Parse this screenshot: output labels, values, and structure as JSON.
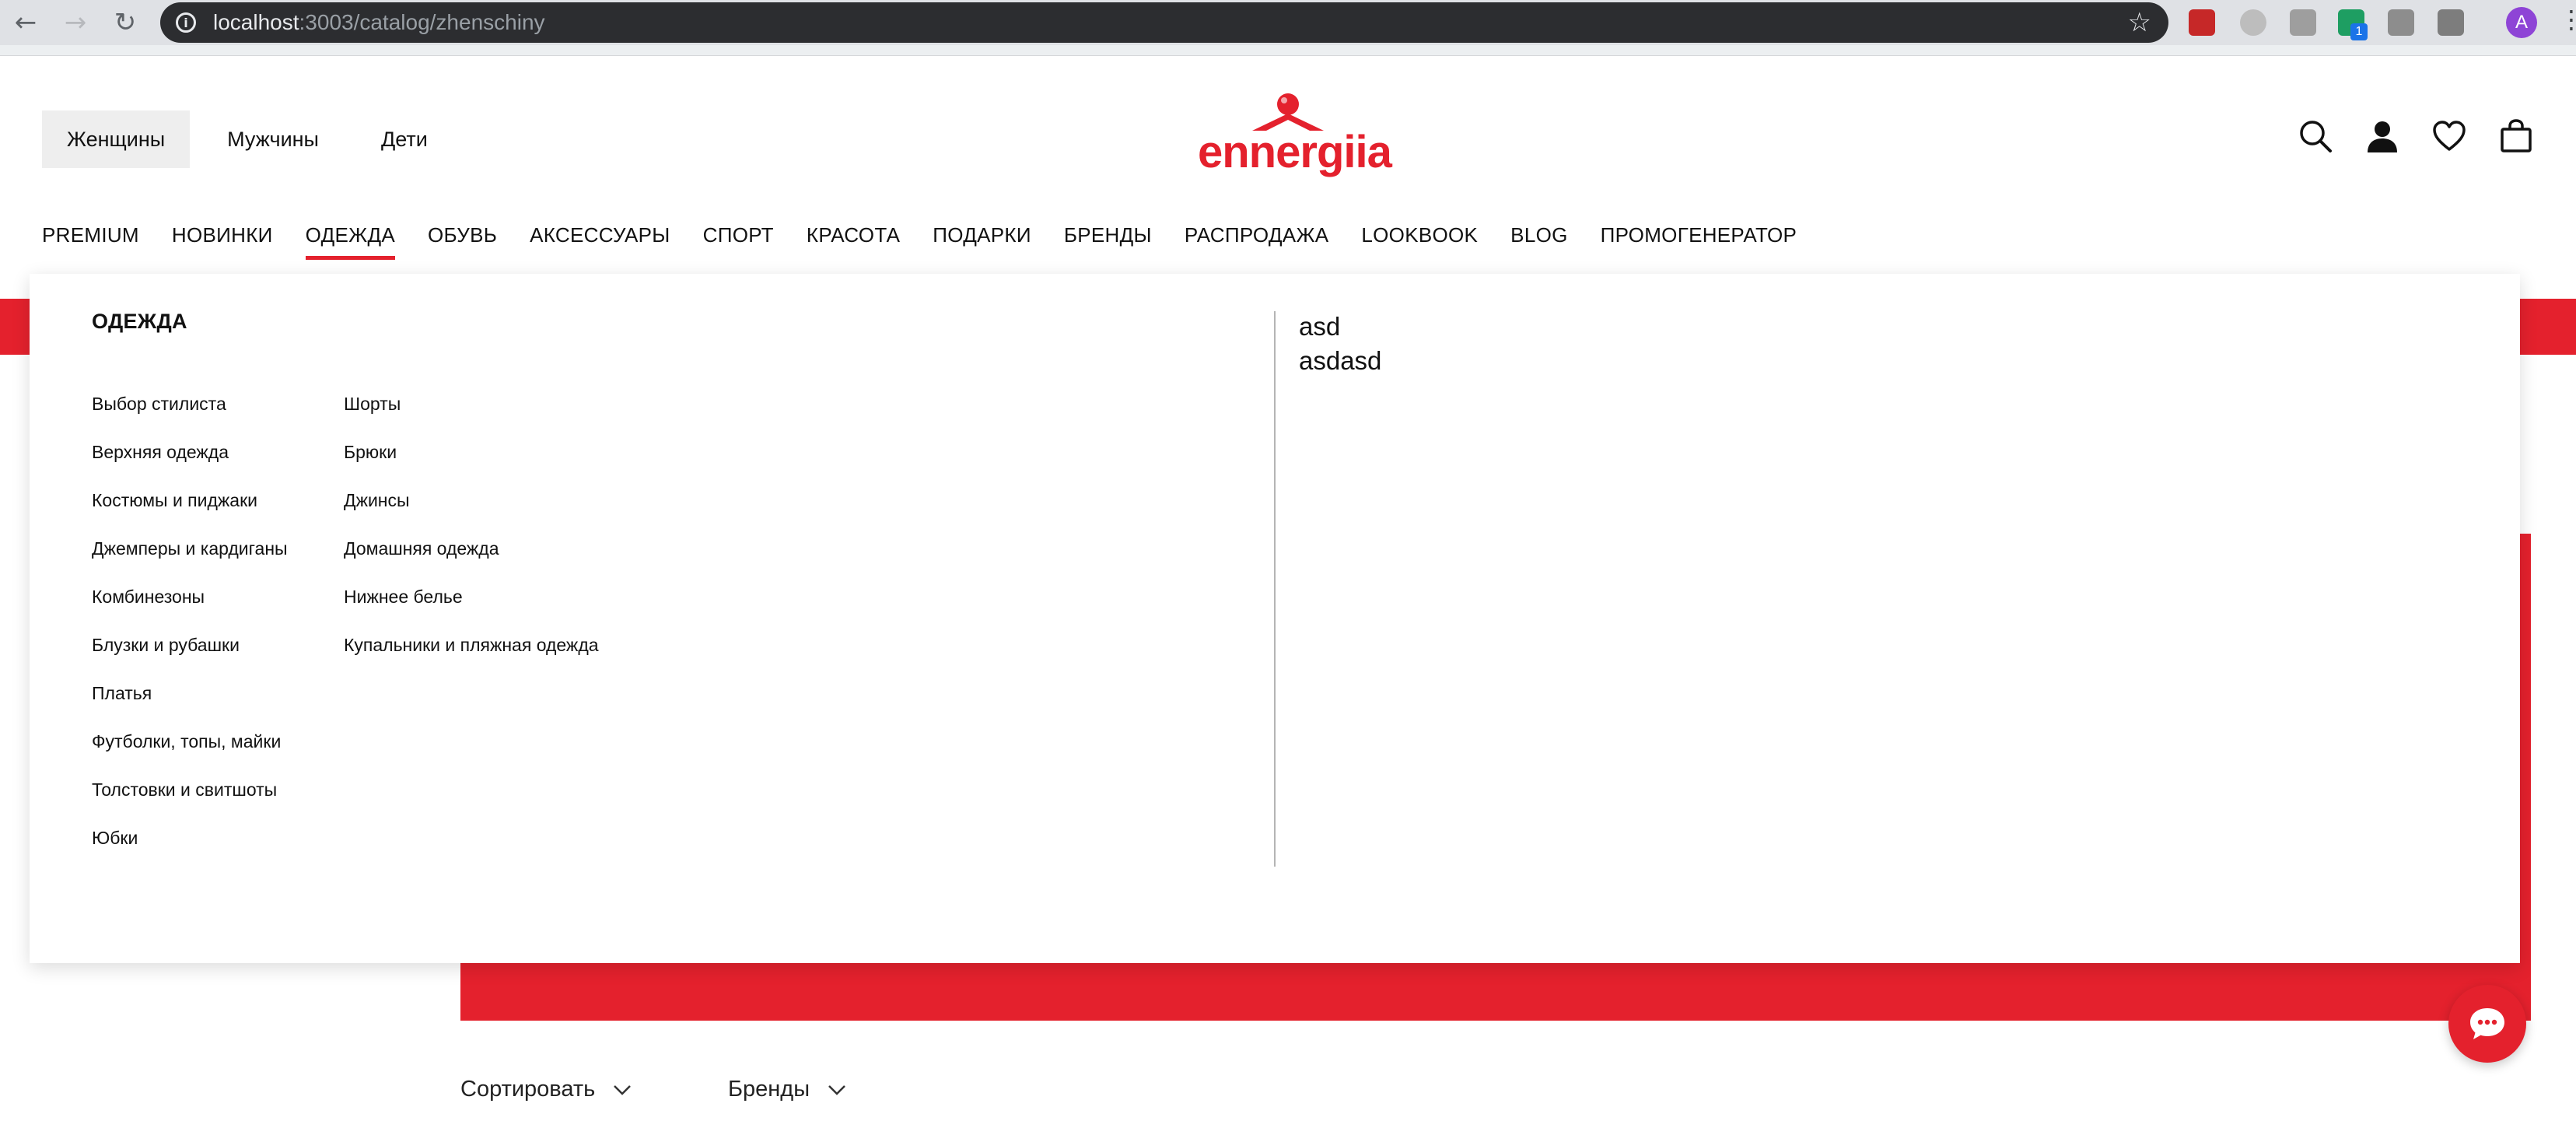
{
  "browser": {
    "url_host": "localhost",
    "url_path": ":3003/catalog/zhenschiny",
    "ext_badge": "1",
    "profile_initial": "A"
  },
  "header": {
    "gender_tabs": [
      "Женщины",
      "Мужчины",
      "Дети"
    ],
    "logo_text": "ennergiia",
    "brand_color": "#e4212d"
  },
  "main_nav": [
    "PREMIUM",
    "НОВИНКИ",
    "ОДЕЖДА",
    "ОБУВЬ",
    "АКСЕССУАРЫ",
    "СПОРТ",
    "КРАСОТА",
    "ПОДАРКИ",
    "БРЕНДЫ",
    "РАСПРОДАЖА",
    "LOOKBOOK",
    "BLOG",
    "ПРОМОГЕНЕРАТОР"
  ],
  "dropdown": {
    "title": "ОДЕЖДА",
    "col1": [
      "Выбор стилиста",
      "Верхняя одежда",
      "Костюмы и пиджаки",
      "Джемперы и кардиганы",
      "Комбинезоны",
      "Блузки и рубашки",
      "Платья",
      "Футболки, топы, майки",
      "Толстовки и свитшоты",
      "Юбки"
    ],
    "col2": [
      "Шорты",
      "Брюки",
      "Джинсы",
      "Домашняя одежда",
      "Нижнее белье",
      "Купальники и пляжная одежда"
    ],
    "extra": [
      "asd",
      "asdasd"
    ]
  },
  "filters": {
    "sort_label": "Сортировать",
    "brands_label": "Бренды"
  }
}
